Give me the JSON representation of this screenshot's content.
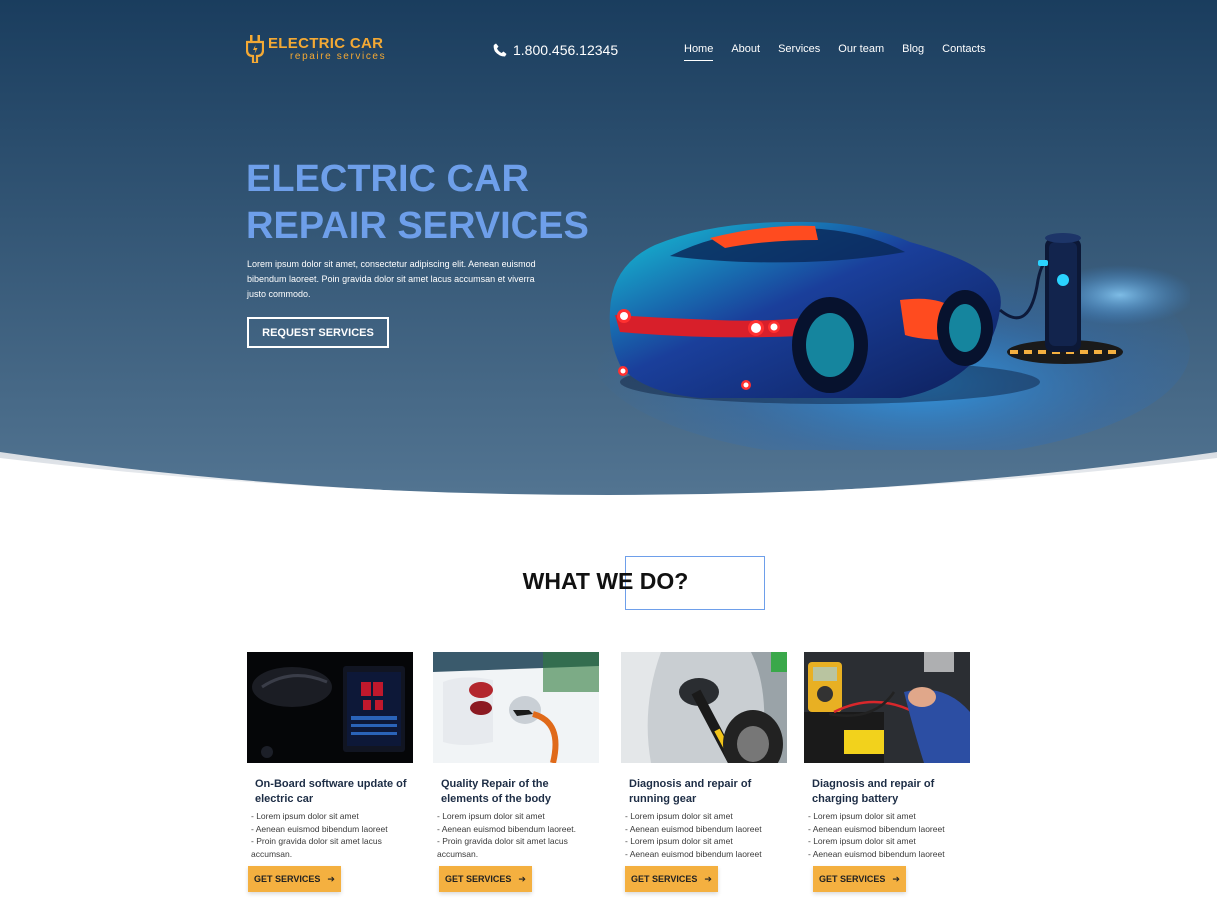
{
  "colors": {
    "hero_top": "#1a3d5e",
    "hero_bottom": "#4f7191",
    "accent_orange": "#f4b040",
    "accent_blue": "#6e9fea"
  },
  "header": {
    "logo_title": "ELECTRIC CAR",
    "logo_subtitle": "repaire services",
    "logo_icon": "plug-icon",
    "phone_icon": "phone-icon",
    "phone": "1.800.456.12345",
    "nav": [
      {
        "label": "Home",
        "active": true
      },
      {
        "label": "About"
      },
      {
        "label": "Services"
      },
      {
        "label": "Our team"
      },
      {
        "label": "Blog"
      },
      {
        "label": "Contacts"
      }
    ]
  },
  "hero": {
    "title_line1": "ELECTRIC CAR",
    "title_line2": "REPAIR SERVICES",
    "text": "Lorem ipsum dolor sit amet, consectetur adipiscing elit. Aenean euismod bibendum laoreet.  Poin gravida dolor sit amet lacus accumsan et viverra justo commodo.",
    "button": "REQUEST SERVICES",
    "image": "electric-car-charging-illustration"
  },
  "section": {
    "title": "WHAT WE DO?"
  },
  "services": [
    {
      "title": "On-Board software update of electric car",
      "image": "dashboard-display-photo",
      "items": [
        "- Lorem ipsum dolor sit amet",
        "- Aenean euismod bibendum laoreet",
        "- Proin gravida dolor sit amet lacus accumsan."
      ],
      "button": "GET SERVICES"
    },
    {
      "title": "Quality Repair of the elements of the body",
      "image": "car-charging-plug-photo",
      "items": [
        "- Lorem ipsum dolor sit amet",
        "- Aenean euismod bibendum laoreet.",
        "- Proin gravida dolor sit amet lacus accumsan."
      ],
      "button": "GET SERVICES"
    },
    {
      "title": "Diagnosis and repair of running gear",
      "image": "charging-port-wheel-photo",
      "items": [
        "- Lorem ipsum dolor sit amet",
        "- Aenean euismod bibendum laoreet",
        "- Lorem ipsum dolor sit amet",
        "- Aenean euismod bibendum laoreet"
      ],
      "button": "GET SERVICES"
    },
    {
      "title": "Diagnosis  and repair of charging battery",
      "image": "multimeter-battery-photo",
      "items": [
        "- Lorem ipsum dolor sit amet",
        "- Aenean euismod bibendum laoreet",
        "- Lorem ipsum dolor sit amet",
        "- Aenean euismod bibendum laoreet"
      ],
      "button": "GET SERVICES"
    }
  ]
}
